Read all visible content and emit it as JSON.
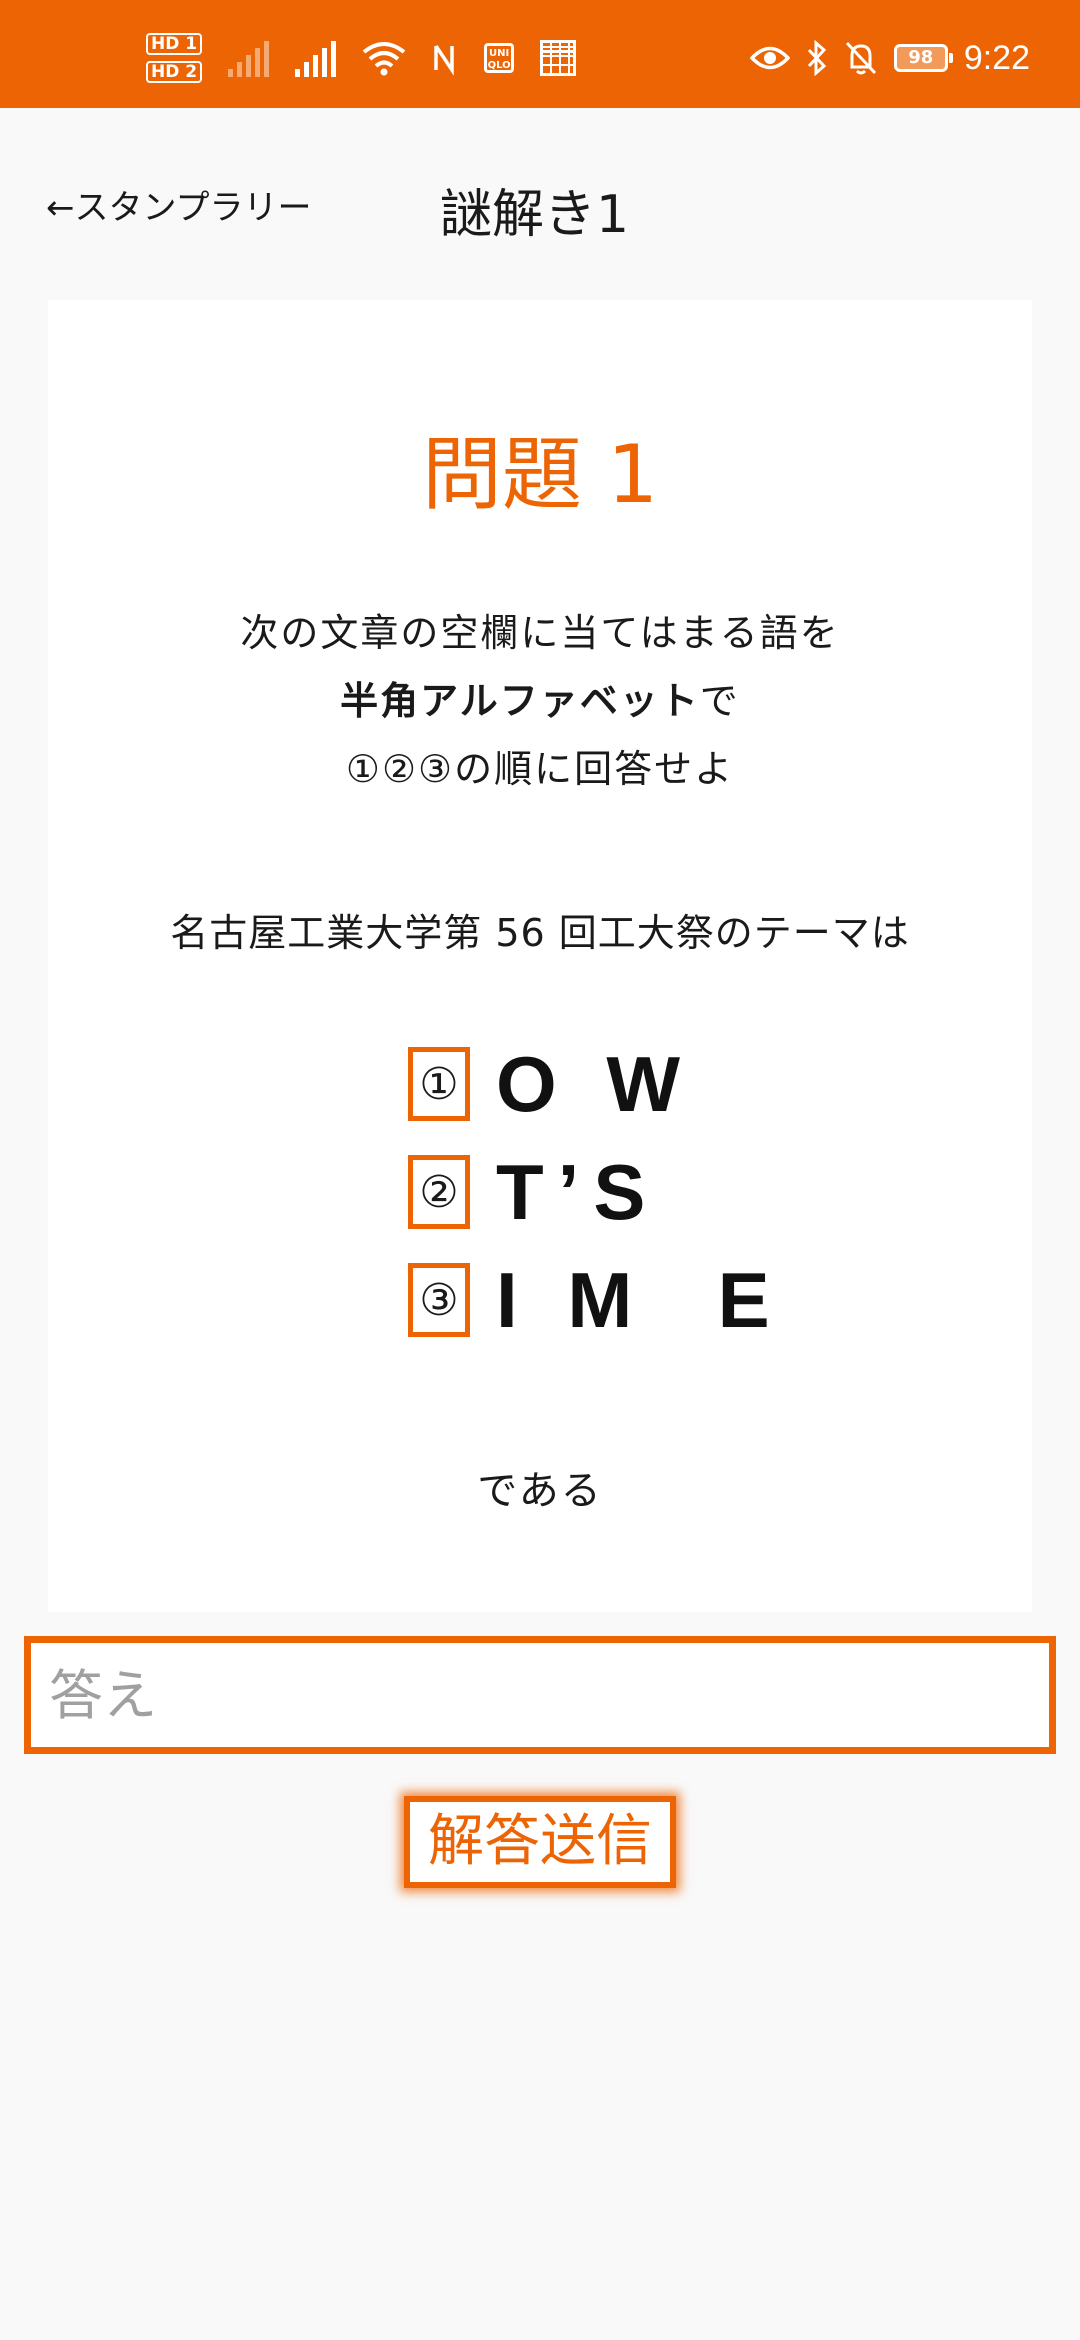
{
  "status_bar": {
    "hd1": "HD 1",
    "hd2": "HD 2",
    "uniqlo_top": "UNI",
    "uniqlo_bottom": "QLO",
    "battery": "98",
    "time": "9:22",
    "color": "#ec6403"
  },
  "header": {
    "back_label": "←スタンプラリー",
    "title": "謎解き1"
  },
  "card": {
    "question_title": "問題 1",
    "instructions": {
      "line1": "次の文章の空欄に当てはまる語を",
      "line2_bold": "半角アルファベット",
      "line2_rest": "で",
      "line3": "①②③の順に回答せよ"
    },
    "theme_sentence": "名古屋工業大学第 56 回工大祭のテーマは",
    "blanks": [
      {
        "marker": "①",
        "text": "O W"
      },
      {
        "marker": "②",
        "text": "T’S"
      },
      {
        "marker": "③",
        "text": "I M  E"
      }
    ],
    "closing": "である"
  },
  "answer": {
    "placeholder": "答え",
    "value": ""
  },
  "submit": {
    "label": "解答送信"
  },
  "colors": {
    "accent": "#ec6403",
    "background": "#f9f9f9",
    "card": "#ffffff"
  }
}
